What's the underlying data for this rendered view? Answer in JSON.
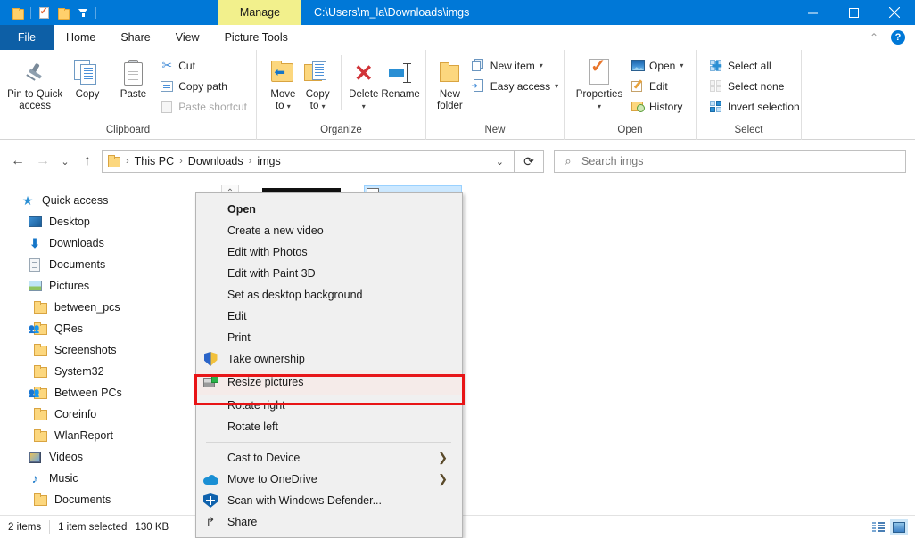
{
  "titlebar": {
    "path": "C:\\Users\\m_la\\Downloads\\imgs",
    "manage_tab": "Manage",
    "quick_access": [
      {
        "name": "properties-quick-icon",
        "icon": "folder-icon"
      },
      {
        "name": "new-folder-quick-icon",
        "icon": "properties-icon"
      },
      {
        "name": "folder-quick-icon",
        "icon": "folder-icon"
      },
      {
        "name": "customize-quick-access-icon",
        "icon": "dropdown-icon"
      }
    ],
    "window_controls": {
      "minimize": "minimize",
      "maximize": "maximize",
      "close": "close"
    }
  },
  "tabs": [
    {
      "label": "File",
      "state": "file"
    },
    {
      "label": "Home",
      "state": "active"
    },
    {
      "label": "Share",
      "state": "normal"
    },
    {
      "label": "View",
      "state": "normal"
    },
    {
      "label": "Picture Tools",
      "state": "contextual"
    }
  ],
  "ribbon": {
    "help_icon": "?",
    "collapse_icon": "chevron-up-icon",
    "groups": [
      {
        "title": "Clipboard",
        "big": [
          {
            "label": "Pin to Quick\naccess",
            "line1": "Pin to Quick",
            "line2": "access",
            "icon": "pin-icon"
          },
          {
            "label": "Copy",
            "line1": "Copy",
            "line2": "",
            "icon": "copy-icon"
          },
          {
            "label": "Paste",
            "line1": "Paste",
            "line2": "",
            "icon": "paste-icon"
          }
        ],
        "small": [
          {
            "label": "Cut",
            "icon": "scissors-icon",
            "disabled": false
          },
          {
            "label": "Copy path",
            "icon": "copy-path-icon",
            "disabled": false
          },
          {
            "label": "Paste shortcut",
            "icon": "paste-shortcut-icon",
            "disabled": true
          }
        ]
      },
      {
        "title": "Organize",
        "big": [
          {
            "line1": "Move",
            "line2": "to",
            "icon": "move-to-icon",
            "caret": true
          },
          {
            "line1": "Copy",
            "line2": "to",
            "icon": "copy-to-icon",
            "caret": true
          },
          {
            "line1": "Delete",
            "line2": "",
            "icon": "delete-icon",
            "caret": true
          },
          {
            "line1": "Rename",
            "line2": "",
            "icon": "rename-icon",
            "caret": false
          }
        ],
        "small": []
      },
      {
        "title": "New",
        "big": [
          {
            "line1": "New",
            "line2": "folder",
            "icon": "new-folder-icon",
            "caret": false
          }
        ],
        "small": [
          {
            "label": "New item",
            "icon": "new-item-icon",
            "caret": true
          },
          {
            "label": "Easy access",
            "icon": "easy-access-icon",
            "caret": true
          }
        ]
      },
      {
        "title": "Open",
        "big": [
          {
            "line1": "Properties",
            "line2": "",
            "icon": "properties-icon",
            "caret": true
          }
        ],
        "small": [
          {
            "label": "Open",
            "icon": "open-picture-icon",
            "caret": true
          },
          {
            "label": "Edit",
            "icon": "edit-pencil-icon",
            "caret": false
          },
          {
            "label": "History",
            "icon": "history-icon",
            "caret": false
          }
        ]
      },
      {
        "title": "Select",
        "big": [],
        "small": [
          {
            "label": "Select all",
            "icon": "select-all-icon"
          },
          {
            "label": "Select none",
            "icon": "select-none-icon"
          },
          {
            "label": "Invert selection",
            "icon": "invert-selection-icon"
          }
        ]
      }
    ]
  },
  "navbar": {
    "back_icon": "back-arrow-icon",
    "forward_icon": "forward-arrow-icon",
    "recent_icon": "chevron-down-icon",
    "up_icon": "up-arrow-icon",
    "breadcrumbs": [
      "This PC",
      "Downloads",
      "imgs"
    ],
    "breadcrumb_separator": "›",
    "address_chevron": "chevron-down-icon",
    "refresh_icon": "refresh-icon",
    "search_placeholder": "Search imgs",
    "search_value": "",
    "search_icon": "search-icon"
  },
  "sidebar": {
    "items": [
      {
        "label": "Quick access",
        "icon": "star-icon",
        "indent": 0
      },
      {
        "label": "Desktop",
        "icon": "desktop-icon",
        "indent": 1
      },
      {
        "label": "Downloads",
        "icon": "downloads-icon",
        "indent": 1
      },
      {
        "label": "Documents",
        "icon": "documents-icon",
        "indent": 1
      },
      {
        "label": "Pictures",
        "icon": "pictures-icon",
        "indent": 1
      },
      {
        "label": "between_pcs",
        "icon": "folder-icon",
        "indent": 1
      },
      {
        "label": "QRes",
        "icon": "shared-folder-icon",
        "indent": 1
      },
      {
        "label": "Screenshots",
        "icon": "folder-icon",
        "indent": 1
      },
      {
        "label": "System32",
        "icon": "folder-icon",
        "indent": 1
      },
      {
        "label": "Between PCs",
        "icon": "shared-folder-icon",
        "indent": 1
      },
      {
        "label": "Coreinfo",
        "icon": "folder-icon",
        "indent": 1
      },
      {
        "label": "WlanReport",
        "icon": "folder-icon",
        "indent": 1
      },
      {
        "label": "Videos",
        "icon": "videos-icon",
        "indent": 1
      },
      {
        "label": "Music",
        "icon": "music-icon",
        "indent": 1
      },
      {
        "label": "Documents",
        "icon": "folder-icon",
        "indent": 1
      }
    ]
  },
  "context_menu": {
    "highlighted_item": "Resize pictures",
    "highlight_color": "#e81416",
    "items": [
      {
        "label": "Open",
        "icon": "",
        "bold": true,
        "submenu": false,
        "sep_before": false
      },
      {
        "label": "Create a new video",
        "icon": "",
        "bold": false,
        "submenu": false,
        "sep_before": false
      },
      {
        "label": "Edit with Photos",
        "icon": "",
        "bold": false,
        "submenu": false,
        "sep_before": false
      },
      {
        "label": "Edit with Paint 3D",
        "icon": "",
        "bold": false,
        "submenu": false,
        "sep_before": false
      },
      {
        "label": "Set as desktop background",
        "icon": "",
        "bold": false,
        "submenu": false,
        "sep_before": false
      },
      {
        "label": "Edit",
        "icon": "",
        "bold": false,
        "submenu": false,
        "sep_before": false
      },
      {
        "label": "Print",
        "icon": "",
        "bold": false,
        "submenu": false,
        "sep_before": false
      },
      {
        "label": "Take ownership",
        "icon": "shield-icon",
        "bold": false,
        "submenu": false,
        "sep_before": false
      },
      {
        "label": "Resize pictures",
        "icon": "resize-pictures-icon",
        "bold": false,
        "submenu": false,
        "sep_before": false,
        "highlighted": true
      },
      {
        "label": "Rotate right",
        "icon": "",
        "bold": false,
        "submenu": false,
        "sep_before": false
      },
      {
        "label": "Rotate left",
        "icon": "",
        "bold": false,
        "submenu": false,
        "sep_before": false
      },
      {
        "label": "Cast to Device",
        "icon": "",
        "bold": false,
        "submenu": true,
        "sep_before": true
      },
      {
        "label": "Move to OneDrive",
        "icon": "onedrive-icon",
        "bold": false,
        "submenu": true,
        "sep_before": false
      },
      {
        "label": "Scan with Windows Defender...",
        "icon": "defender-icon",
        "bold": false,
        "submenu": false,
        "sep_before": false
      },
      {
        "label": "Share",
        "icon": "share-icon",
        "bold": false,
        "submenu": false,
        "sep_before": false
      }
    ]
  },
  "statusbar": {
    "item_count": "2 items",
    "selection": "1 item selected",
    "size": "130 KB",
    "view_details_icon": "details-view-icon",
    "view_large_icons_icon": "large-icons-view-icon"
  }
}
